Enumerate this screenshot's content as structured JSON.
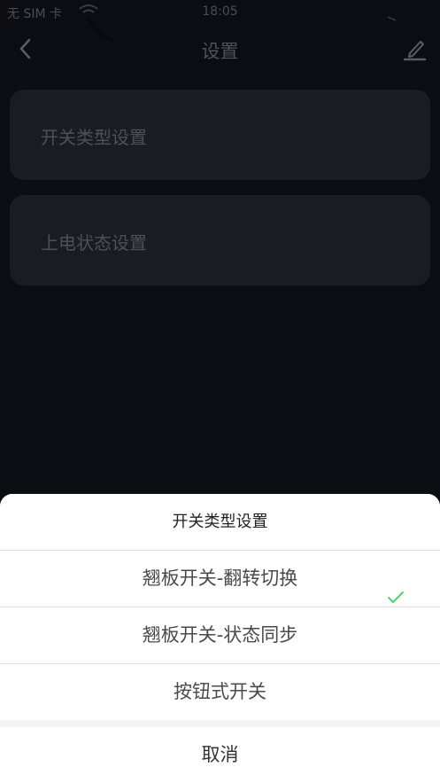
{
  "status_bar": {
    "carrier": "无 SIM 卡",
    "time": "18:05"
  },
  "header": {
    "title": "设置",
    "back_icon": "chevron-left-icon",
    "edit_icon": "pencil-icon"
  },
  "settings": {
    "items": [
      {
        "label": "开关类型设置"
      },
      {
        "label": "上电状态设置"
      }
    ]
  },
  "action_sheet": {
    "title": "开关类型设置",
    "options": [
      {
        "label": "翘板开关-翻转切换",
        "selected": true
      },
      {
        "label": "翘板开关-状态同步",
        "selected": false
      },
      {
        "label": "按钮式开关",
        "selected": false
      }
    ],
    "cancel_label": "取消",
    "check_color": "#4cd964"
  }
}
